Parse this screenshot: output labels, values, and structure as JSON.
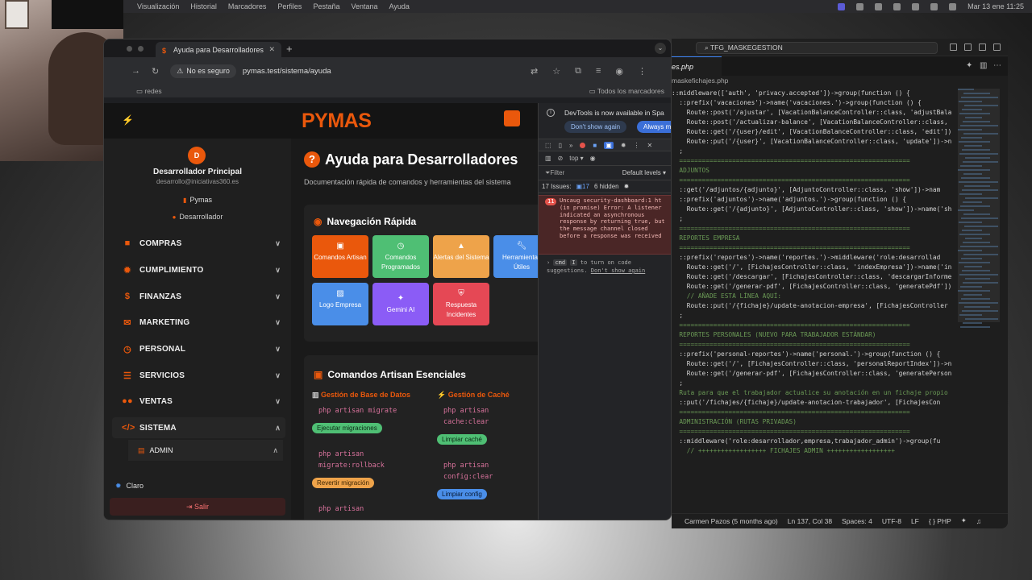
{
  "menubar": {
    "items": [
      "Visualización",
      "Historial",
      "Marcadores",
      "Perfiles",
      "Pestaña",
      "Ventana",
      "Ayuda"
    ],
    "datetime": "Mar 13 ene 11:25"
  },
  "browser": {
    "tab_title": "Ayuda para Desarrolladores",
    "security_label": "No es seguro",
    "url": "pymas.test/sistema/ayuda",
    "bookmark_folder": "redes",
    "all_bookmarks": "Todos los marcadores"
  },
  "app": {
    "logo": "PYMAS",
    "user": {
      "initial": "D",
      "name": "Desarrollador Principal",
      "email": "desarrollo@iniciativas360.es",
      "company": "Pymas",
      "role": "Desarrollador"
    },
    "nav": [
      {
        "label": "COMPRAS",
        "icon": "truck-icon"
      },
      {
        "label": "CUMPLIMIENTO",
        "icon": "gear-icon"
      },
      {
        "label": "FINANZAS",
        "icon": "dollar-icon"
      },
      {
        "label": "MARKETING",
        "icon": "envelope-icon"
      },
      {
        "label": "PERSONAL",
        "icon": "clock-icon"
      },
      {
        "label": "SERVICIOS",
        "icon": "list-icon"
      },
      {
        "label": "VENTAS",
        "icon": "users-icon"
      },
      {
        "label": "SISTEMA",
        "icon": "code-icon"
      }
    ],
    "sub_admin": "ADMIN",
    "theme_label": "Claro",
    "logout_label": "Salir",
    "page_title": "Ayuda para Desarrolladores",
    "page_subtitle": "Documentación rápida de comandos y herramientas del sistema",
    "quick_nav": {
      "title": "Navegación Rápida",
      "buttons": [
        {
          "label": "Comandos Artisan",
          "color": "#ea580c"
        },
        {
          "label": "Comandos Programados",
          "color": "#4fbf74"
        },
        {
          "label": "Alertas del Sistema",
          "color": "#eea34a"
        },
        {
          "label": "Herramientas Útiles",
          "color": "#4a8ee8"
        },
        {
          "label": "Logo Empresa",
          "color": "#4a8ee8"
        },
        {
          "label": "Gemini AI",
          "color": "#8b5cf6"
        },
        {
          "label": "Respuesta Incidentes",
          "color": "#e54855"
        }
      ]
    },
    "artisan": {
      "title": "Comandos Artisan Esenciales",
      "db_section": "Gestión de Base de Datos",
      "cache_section": "Gestión de Caché",
      "db_cmd1": "php artisan migrate",
      "db_pill1": "Ejecutar migraciones",
      "db_cmd2": "php artisan migrate:rollback",
      "db_pill2": "Revertir migración",
      "db_cmd3": "php artisan",
      "cache_cmd1": "php artisan cache:clear",
      "cache_pill1": "Limpiar caché",
      "cache_cmd2": "php artisan config:clear",
      "cache_pill2": "Limpiar config"
    }
  },
  "devtools": {
    "banner": "DevTools is now available in Spa",
    "dont_show": "Don't show again",
    "always": "Always ma",
    "context": "top",
    "filter": "Filter",
    "levels": "Default levels",
    "issues_label": "17 Issues:",
    "issues_count": "17",
    "hidden": "6 hidden",
    "error_count": "11",
    "error_text": "Uncaug security-dashboard:1 ht (in promise) Error: A listener indicated an asynchronous response by returning true, but the message channel closed before a response was received",
    "hint_pre": "cmd",
    "hint_key": "I",
    "hint_text": "to turn on code suggestions.",
    "hint_link": "Don't show again"
  },
  "editor": {
    "search": "TFG_MASKEGESTION",
    "tab": "es.php",
    "crumb": "maskefichajes.php",
    "status": {
      "blame": "Carmen Pazos (5 months ago)",
      "position": "Ln 137, Col 38",
      "spaces": "Spaces: 4",
      "encoding": "UTF-8",
      "eol": "LF",
      "lang": "{ } PHP"
    },
    "lines": [
      "::middleware(['auth', 'privacy.accepted'])->group(function () {",
      "  ::prefix('vacaciones')->name('vacaciones.')->group(function () {",
      "    Route::post('/ajustar', [VacationBalanceController::class, 'adjustBala",
      "    Route::post('/actualizar-balance', [VacationBalanceController::class,",
      "    Route::get('/{user}/edit', [VacationBalanceController::class, 'edit'])",
      "    Route::put('/{user}', [VacationBalanceController::class, 'update'])->n",
      "  ;",
      "",
      "  =============================================================",
      "  ADJUNTOS",
      "  =============================================================",
      "  ::get('/adjuntos/{adjunto}', [AdjuntoController::class, 'show'])->nam",
      "  ::prefix('adjuntos')->name('adjuntos.')->group(function () {",
      "    Route::get('/{adjunto}', [AdjuntoController::class, 'show'])->name('sh",
      "  ;",
      "",
      "",
      "  =============================================================",
      "  REPORTES EMPRESA",
      "  =============================================================",
      "  ::prefix('reportes')->name('reportes.')->middleware('role:desarrollad",
      "    Route::get('/', [FichajesController::class, 'indexEmpresa'])->name('in",
      "    Route::get('/descargar', [FichajesController::class, 'descargarInforme",
      "    Route::get('/generar-pdf', [FichajesController::class, 'generatePdf'])",
      "    // AÑADE ESTA LÍNEA AQUÍ:",
      "    Route::put('/{fichaje}/update-anotacion-empresa', [FichajesController",
      "  ;",
      "",
      "  =============================================================",
      "  REPORTES PERSONALES (NUEVO PARA TRABAJADOR ESTÁNDAR)",
      "  =============================================================",
      "  ::prefix('personal-reportes')->name('personal.')->group(function () {",
      "    Route::get('/', [FichajesController::class, 'personalReportIndex'])->n",
      "    Route::get('/generar-pdf', [FichajesController::class, 'generatePerson",
      "  ;",
      "",
      "  Ruta para que el trabajador actualice su anotación en un fichaje propio",
      "  ::put('/fichajes/{fichaje}/update-anotacion-trabajador', [FichajesCon",
      "",
      "  =============================================================",
      "  ADMINISTRACIÓN (RUTAS PRIVADAS)",
      "  =============================================================",
      "  ::middleware('role:desarrollador,empresa,trabajador_admin')->group(fu",
      "    // ++++++++++++++++++ FICHAJES ADMIN ++++++++++++++++++"
    ]
  }
}
